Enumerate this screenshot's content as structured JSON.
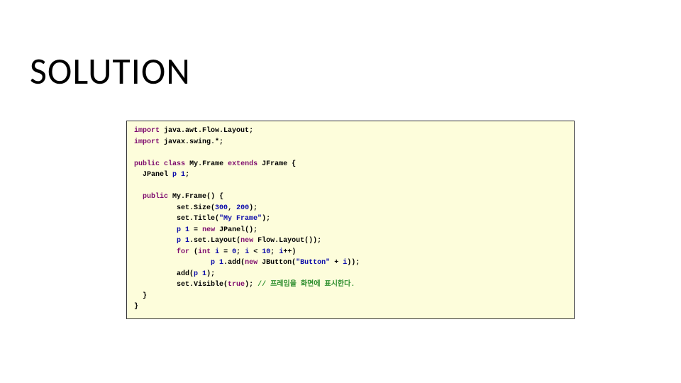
{
  "title": "SOLUTION",
  "code": {
    "kw_import": "import",
    "kw_public": "public",
    "kw_class": "class",
    "kw_extends": "extends",
    "kw_new": "new",
    "kw_for": "for",
    "kw_int": "int",
    "kw_true": "true",
    "imp1": "java.awt.Flow.Layout",
    "imp2": "javax.swing.*",
    "classname": "My.Frame",
    "superclass": "JFrame",
    "fieldType": "JPanel",
    "fieldName": "p 1",
    "ctor": "My.Frame",
    "setsize": "set.Size",
    "size_w": "300",
    "size_h": "200",
    "settitle": "set.Title",
    "titleStr": "\"My Frame\"",
    "p1a": "p 1",
    "newpanel": "JPanel",
    "p1b": "p 1",
    "setlayout": "set.Layout",
    "flowlayout": "Flow.Layout",
    "loopvar": "i",
    "loop_init": "0",
    "loop_limit": "10",
    "p1c": "p 1",
    "addfn": "add",
    "jbutton": "JButton",
    "btnStr": "\"Button\"",
    "plusvar": "i",
    "addp": "add",
    "p1d": "p 1",
    "setvis": "set.Visible",
    "comment": "// 프레임을 화면에 표시한다.",
    "semi": ";",
    "lbrace": "{",
    "rbrace": "}",
    "lparen": "(",
    "rparen": ")",
    "comma": ",",
    "plus": "+",
    "lt": "<",
    "eq": "=",
    "ppp": "++",
    "dot": "."
  }
}
